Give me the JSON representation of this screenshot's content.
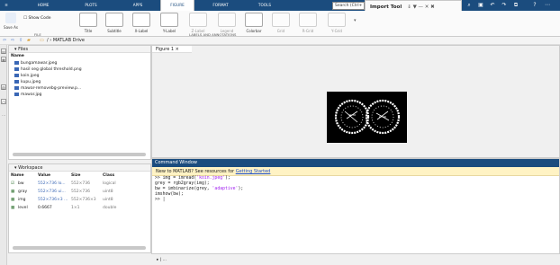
{
  "tabs": [
    "HOME",
    "PLOTS",
    "APPS",
    "FIGURE",
    "FORMAT",
    "TOOLS"
  ],
  "search_text": "Search (Ctrl+",
  "import_tool": {
    "label": "Import Tool",
    "controls": "⇓  ▼  —  ✕  ✖"
  },
  "ribbon": {
    "save_as": "Save As",
    "show_code": "Show Code",
    "buttons": [
      "Title",
      "Subtitle",
      "X-Label",
      "Y-Label",
      "Z-Label",
      "Legend",
      "Colorbar",
      "Grid",
      "R-Grid",
      "Y-Grid"
    ],
    "group_file": "FILE",
    "group_labels": "LABELS AND ANNOTATIONS"
  },
  "address": "/ › MATLAB Drive",
  "files": {
    "title": "Files",
    "col_name": "Name",
    "items": [
      "bungamawar.jpeg",
      "hasil seg global threshold.png",
      "koin.jpeg",
      "kupu.jpeg",
      "mawar-removebg-preview.p...",
      "mawar.jpg"
    ]
  },
  "figure": {
    "tab": "Figure 1 ×"
  },
  "workspace": {
    "title": "Workspace",
    "headers": [
      "Name",
      "Value",
      "Size",
      "Class"
    ],
    "rows": [
      {
        "name": "bw",
        "value": "552×736 lo...",
        "size": "552×736",
        "cls": "logical"
      },
      {
        "name": "gray",
        "value": "552×736 ui...",
        "size": "552×736",
        "cls": "uint8"
      },
      {
        "name": "img",
        "value": "552×736×3 ...",
        "size": "552×736×3",
        "cls": "uint8"
      },
      {
        "name": "level",
        "value": "0.6667",
        "size": "1×1",
        "cls": "double"
      }
    ]
  },
  "command": {
    "title": "Command Window",
    "banner_prefix": "New to MATLAB? See resources for ",
    "banner_link": "Getting Started",
    "lines": [
      {
        "pre": ">> img = imread(",
        "str": "'koin.jpeg'",
        "post": ");"
      },
      {
        "pre": "grey = rgb2gray(img);",
        "str": "",
        "post": ""
      },
      {
        "pre": "bw = imbinarize(grey, ",
        "str": "'adaptive'",
        "post": ");"
      },
      {
        "pre": "imshow(bw);",
        "str": "",
        "post": ""
      },
      {
        "pre": ">> |",
        "str": "",
        "post": ""
      }
    ]
  },
  "status": "▸ | ...",
  "colors": {
    "accent": "#1b4c7e",
    "banner": "#fff3c4",
    "link": "#1a4cc9"
  }
}
